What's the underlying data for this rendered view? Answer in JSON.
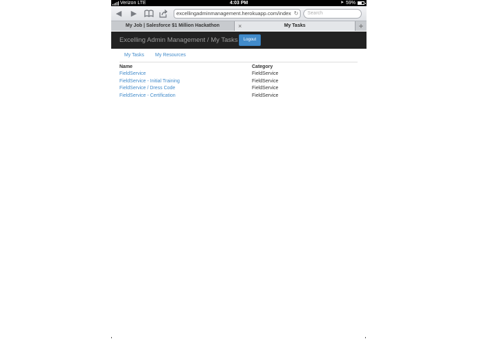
{
  "status_bar": {
    "carrier": "Verizon",
    "network": "LTE",
    "time": "4:03 PM",
    "battery": "59%",
    "battery_level": 0.59
  },
  "browser": {
    "url": "excellingadminmanagement.herokuapp.com/index",
    "search_placeholder": "Search",
    "tabs": [
      {
        "label": "My Job | Salesforce $1 Million Hackathon"
      },
      {
        "label": "My Tasks"
      }
    ],
    "close_tab_glyph": "×",
    "new_tab_glyph": "+"
  },
  "page": {
    "brand": "Excelling Admin Management / My Tasks",
    "logout_label": "Logout",
    "subnav": [
      {
        "label": "My Tasks"
      },
      {
        "label": "My Resources"
      }
    ],
    "table": {
      "headers": {
        "name": "Name",
        "category": "Category"
      },
      "rows": [
        {
          "name": "FieldService",
          "category": "FieldService"
        },
        {
          "name": "FieldService - Initial Training",
          "category": "FieldService"
        },
        {
          "name": "FieldService / Dress Code",
          "category": "FieldService"
        },
        {
          "name": "FieldService - Certification",
          "category": "FieldService"
        }
      ]
    }
  },
  "colors": {
    "navbar_bg": "#222222",
    "link": "#428bca",
    "button_primary": "#428bca"
  }
}
